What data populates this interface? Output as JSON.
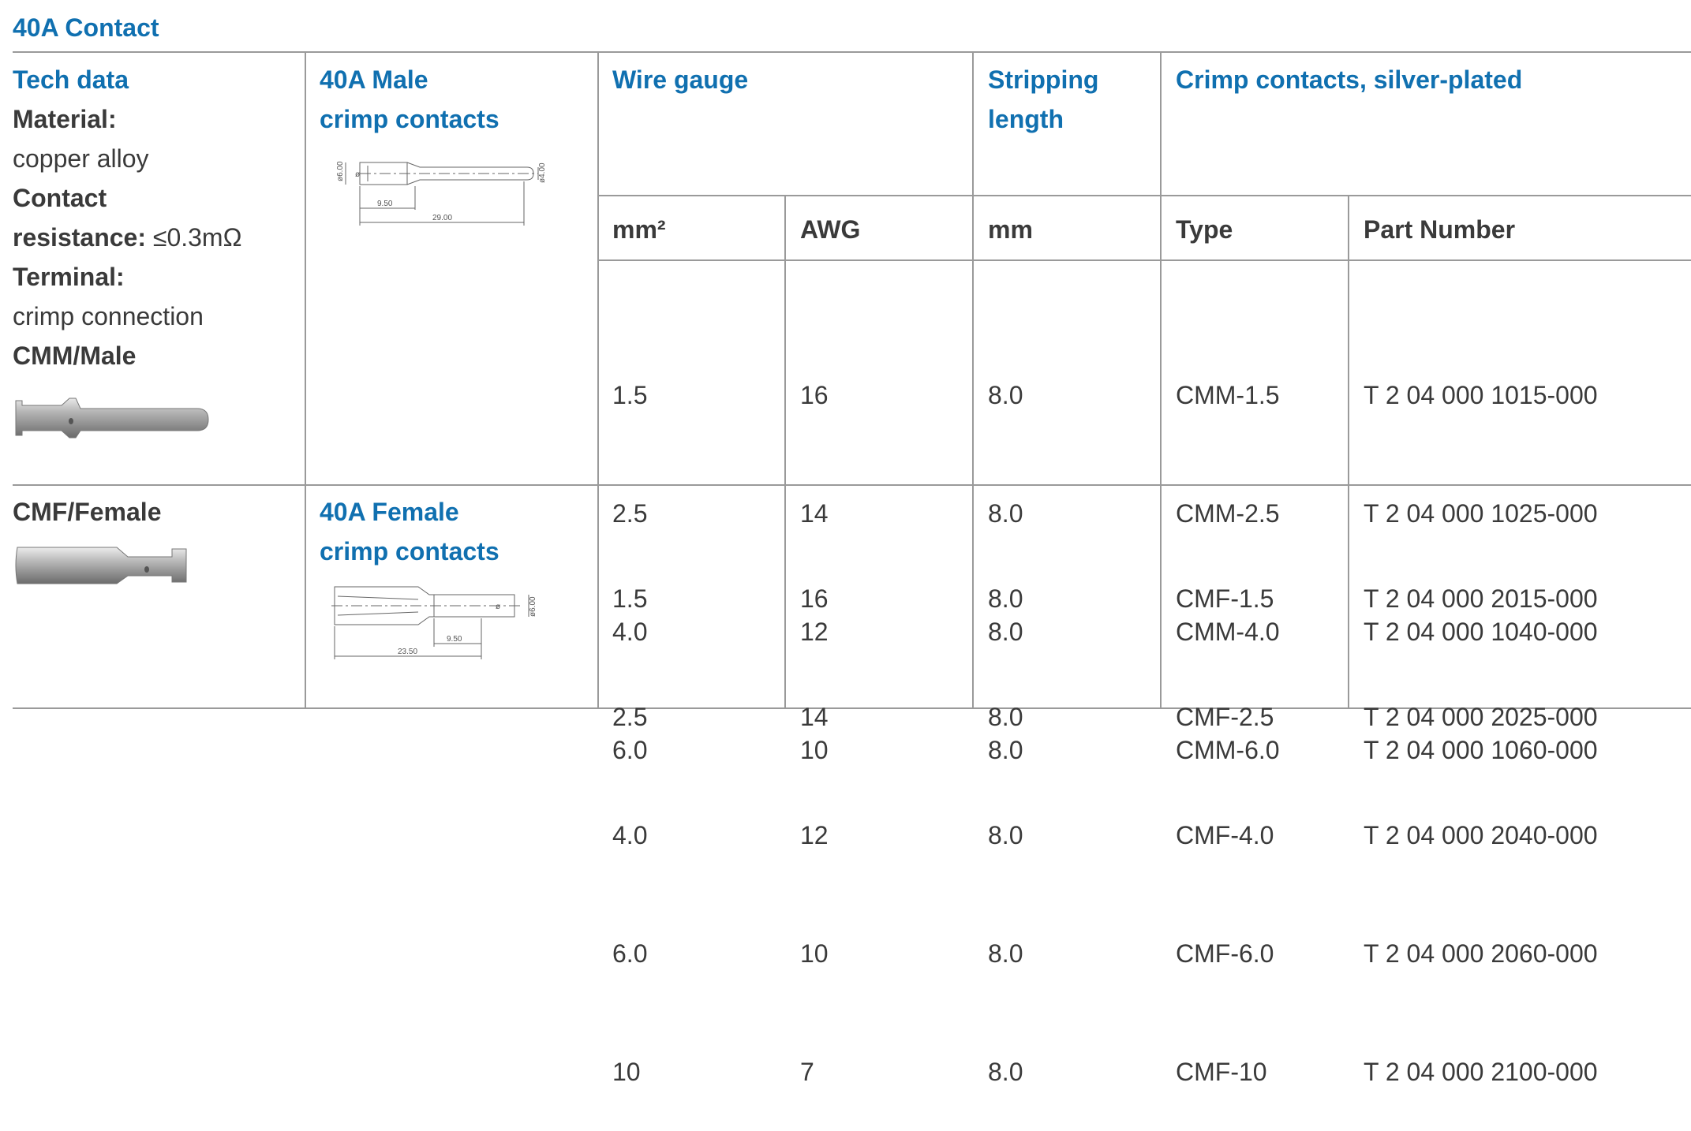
{
  "title": "40A Contact",
  "tech": {
    "heading": "Tech data",
    "material_label": "Material:",
    "material_value": "copper alloy",
    "contact_label": "Contact",
    "resistance_label": "resistance:",
    "resistance_value": "≤0.3mΩ",
    "terminal_label": "Terminal:",
    "terminal_value": "crimp connection",
    "male_label": "CMM/Male",
    "female_label": "CMF/Female"
  },
  "male_heading": [
    "40A Male",
    "crimp contacts"
  ],
  "female_heading": [
    "40A Female",
    "crimp contacts"
  ],
  "male_drawing": {
    "dia_left": "ø6.00",
    "dia_right": "ø4.00",
    "d1": "9.50",
    "d2": "29.00",
    "phi": "ø"
  },
  "female_drawing": {
    "dia_right": "ø6.00",
    "d1": "9.50",
    "d2": "23.50",
    "phi": "ø"
  },
  "headers": {
    "wire_gauge": "Wire gauge",
    "stripping": [
      "Stripping",
      "length"
    ],
    "crimp": "Crimp contacts, silver-plated",
    "mm2": "mm²",
    "awg": "AWG",
    "mm": "mm",
    "type": "Type",
    "part_number": "Part Number"
  },
  "male_rows": [
    {
      "mm2": "1.5",
      "awg": "16",
      "mm": "8.0",
      "type": "CMM-1.5",
      "part": "T 2 04 000 1015-000"
    },
    {
      "mm2": "2.5",
      "awg": "14",
      "mm": "8.0",
      "type": "CMM-2.5",
      "part": "T 2 04 000 1025-000"
    },
    {
      "mm2": "4.0",
      "awg": "12",
      "mm": "8.0",
      "type": "CMM-4.0",
      "part": "T 2 04 000 1040-000"
    },
    {
      "mm2": "6.0",
      "awg": "10",
      "mm": "8.0",
      "type": "CMM-6.0",
      "part": "T 2 04 000 1060-000"
    }
  ],
  "female_rows": [
    {
      "mm2": "1.5",
      "awg": "16",
      "mm": "8.0",
      "type": "CMF-1.5",
      "part": "T 2 04 000 2015-000"
    },
    {
      "mm2": "2.5",
      "awg": "14",
      "mm": "8.0",
      "type": "CMF-2.5",
      "part": "T 2 04 000 2025-000"
    },
    {
      "mm2": "4.0",
      "awg": "12",
      "mm": "8.0",
      "type": "CMF-4.0",
      "part": "T 2 04 000 2040-000"
    },
    {
      "mm2": "6.0",
      "awg": "10",
      "mm": "8.0",
      "type": "CMF-6.0",
      "part": "T 2 04 000 2060-000"
    },
    {
      "mm2": "10",
      "awg": "7",
      "mm": "8.0",
      "type": "CMF-10",
      "part": "T 2 04 000 2100-000"
    }
  ]
}
